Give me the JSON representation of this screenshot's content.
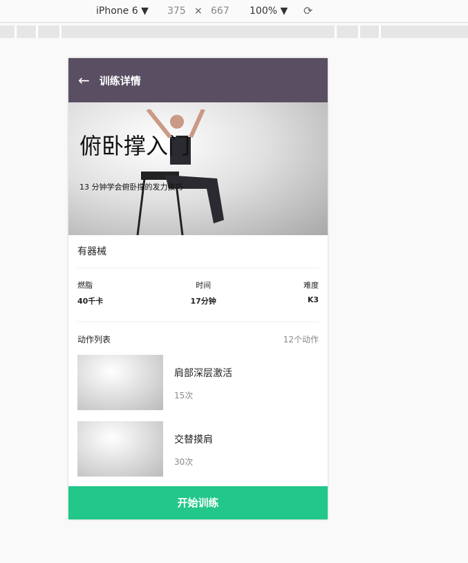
{
  "devtools": {
    "device": "iPhone 6 ▼",
    "width": "375",
    "times": "×",
    "height": "667",
    "zoom": "100% ▼"
  },
  "nav": {
    "title": "训练详情"
  },
  "hero": {
    "title": "俯卧撑入门",
    "subtitle": "13 分钟学会俯卧撑的发力技巧"
  },
  "equipment": "有器械",
  "stats": [
    {
      "label": "燃脂",
      "value": "40千卡"
    },
    {
      "label": "时间",
      "value": "17分钟"
    },
    {
      "label": "难度",
      "value": "K3"
    }
  ],
  "list": {
    "title": "动作列表",
    "count": "12个动作",
    "items": [
      {
        "name": "肩部深层激活",
        "reps": "15次"
      },
      {
        "name": "交替摸肩",
        "reps": "30次"
      }
    ]
  },
  "start_label": "开始训练",
  "colors": {
    "nav": "#5a4f62",
    "start": "#23c78a"
  }
}
